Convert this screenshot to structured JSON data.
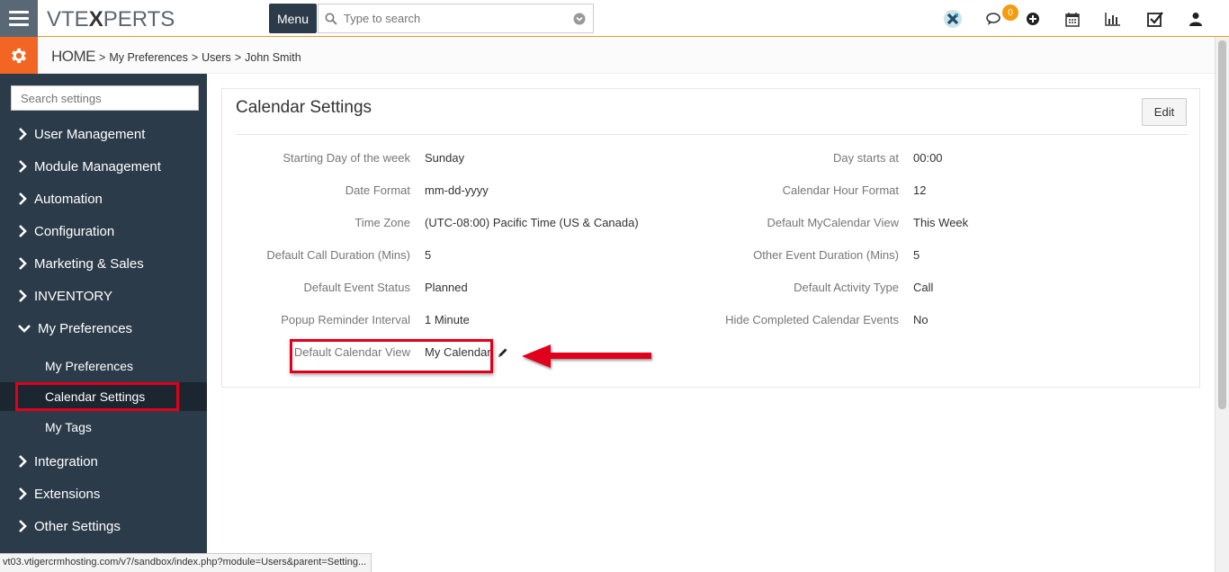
{
  "app": {
    "logo_left": "VTE",
    "logo_x": "X",
    "logo_right": "PERTS",
    "menu_label": "Menu",
    "search_placeholder": "Type to search",
    "notification_count": "0"
  },
  "breadcrumb": {
    "home": "HOME",
    "sep": ">",
    "items": [
      "My Preferences",
      "Users",
      "John Smith"
    ]
  },
  "sidebar": {
    "search_placeholder": "Search settings",
    "items": [
      {
        "label": "User Management"
      },
      {
        "label": "Module Management"
      },
      {
        "label": "Automation"
      },
      {
        "label": "Configuration"
      },
      {
        "label": "Marketing & Sales"
      },
      {
        "label": "INVENTORY"
      },
      {
        "label": "My Preferences",
        "expanded": true
      }
    ],
    "sub_items": [
      {
        "label": "My Preferences"
      },
      {
        "label": "Calendar Settings",
        "active": true
      },
      {
        "label": "My Tags"
      }
    ],
    "items_after": [
      {
        "label": "Integration"
      },
      {
        "label": "Extensions"
      },
      {
        "label": "Other Settings"
      }
    ]
  },
  "panel": {
    "title": "Calendar Settings",
    "edit_label": "Edit",
    "left_fields": [
      {
        "label": "Starting Day of the week",
        "value": "Sunday"
      },
      {
        "label": "Date Format",
        "value": "mm-dd-yyyy"
      },
      {
        "label": "Time Zone",
        "value": "(UTC-08:00) Pacific Time (US & Canada)"
      },
      {
        "label": "Default Call Duration (Mins)",
        "value": "5"
      },
      {
        "label": "Default Event Status",
        "value": "Planned"
      },
      {
        "label": "Popup Reminder Interval",
        "value": "1 Minute"
      },
      {
        "label": "Default Calendar View",
        "value": "My Calendar"
      }
    ],
    "right_fields": [
      {
        "label": "Day starts at",
        "value": "00:00"
      },
      {
        "label": "Calendar Hour Format",
        "value": "12"
      },
      {
        "label": "Default MyCalendar View",
        "value": "This Week"
      },
      {
        "label": "Other Event Duration (Mins)",
        "value": "5"
      },
      {
        "label": "Default Activity Type",
        "value": "Call"
      },
      {
        "label": "Hide Completed Calendar Events",
        "value": "No"
      }
    ]
  },
  "status_url": "vt03.vtigercrmhosting.com/v7/sandbox/index.php?module=Users&parent=Setting...",
  "colors": {
    "sidebar_bg": "#2c3b49",
    "accent_orange": "#f26522",
    "annotation_red": "#e0001b"
  }
}
